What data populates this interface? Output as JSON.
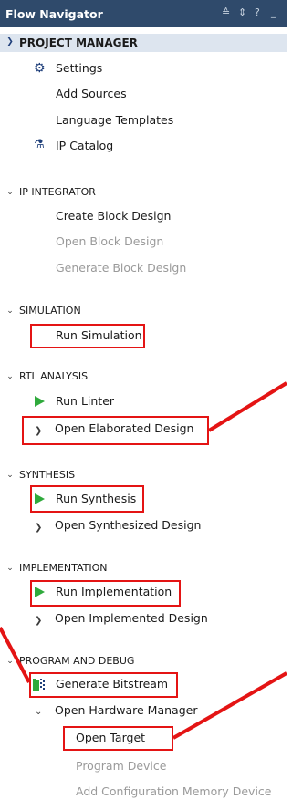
{
  "header": {
    "title": "Flow Navigator",
    "icons": [
      "collapse-all-icon",
      "sort-icon",
      "help-icon",
      "minimize-icon"
    ]
  },
  "project_manager": {
    "title": "PROJECT MANAGER",
    "items": {
      "settings": "Settings",
      "add_sources": "Add Sources",
      "language_templates": "Language Templates",
      "ip_catalog": "IP Catalog"
    }
  },
  "ip_integrator": {
    "title": "IP INTEGRATOR",
    "items": {
      "create_block": "Create Block Design",
      "open_block": "Open Block Design",
      "generate_block": "Generate Block Design"
    }
  },
  "simulation": {
    "title": "SIMULATION",
    "items": {
      "run_simulation": "Run Simulation"
    }
  },
  "rtl_analysis": {
    "title": "RTL ANALYSIS",
    "items": {
      "run_linter": "Run Linter",
      "open_elaborated": "Open Elaborated Design"
    }
  },
  "synthesis": {
    "title": "SYNTHESIS",
    "items": {
      "run_synthesis": "Run Synthesis",
      "open_synthesized": "Open Synthesized Design"
    }
  },
  "implementation": {
    "title": "IMPLEMENTATION",
    "items": {
      "run_implementation": "Run Implementation",
      "open_implemented": "Open Implemented Design"
    }
  },
  "program_debug": {
    "title": "PROGRAM AND DEBUG",
    "items": {
      "generate_bitstream": "Generate Bitstream",
      "open_hw_manager": "Open Hardware Manager",
      "open_target": "Open Target",
      "program_device": "Program Device",
      "add_config_memory": "Add Configuration Memory Device"
    }
  },
  "colors": {
    "header_bg": "#2f4a6b",
    "run_icon": "#2faa3c",
    "highlight": "#e41414",
    "disabled_text": "#9a9a9a"
  }
}
